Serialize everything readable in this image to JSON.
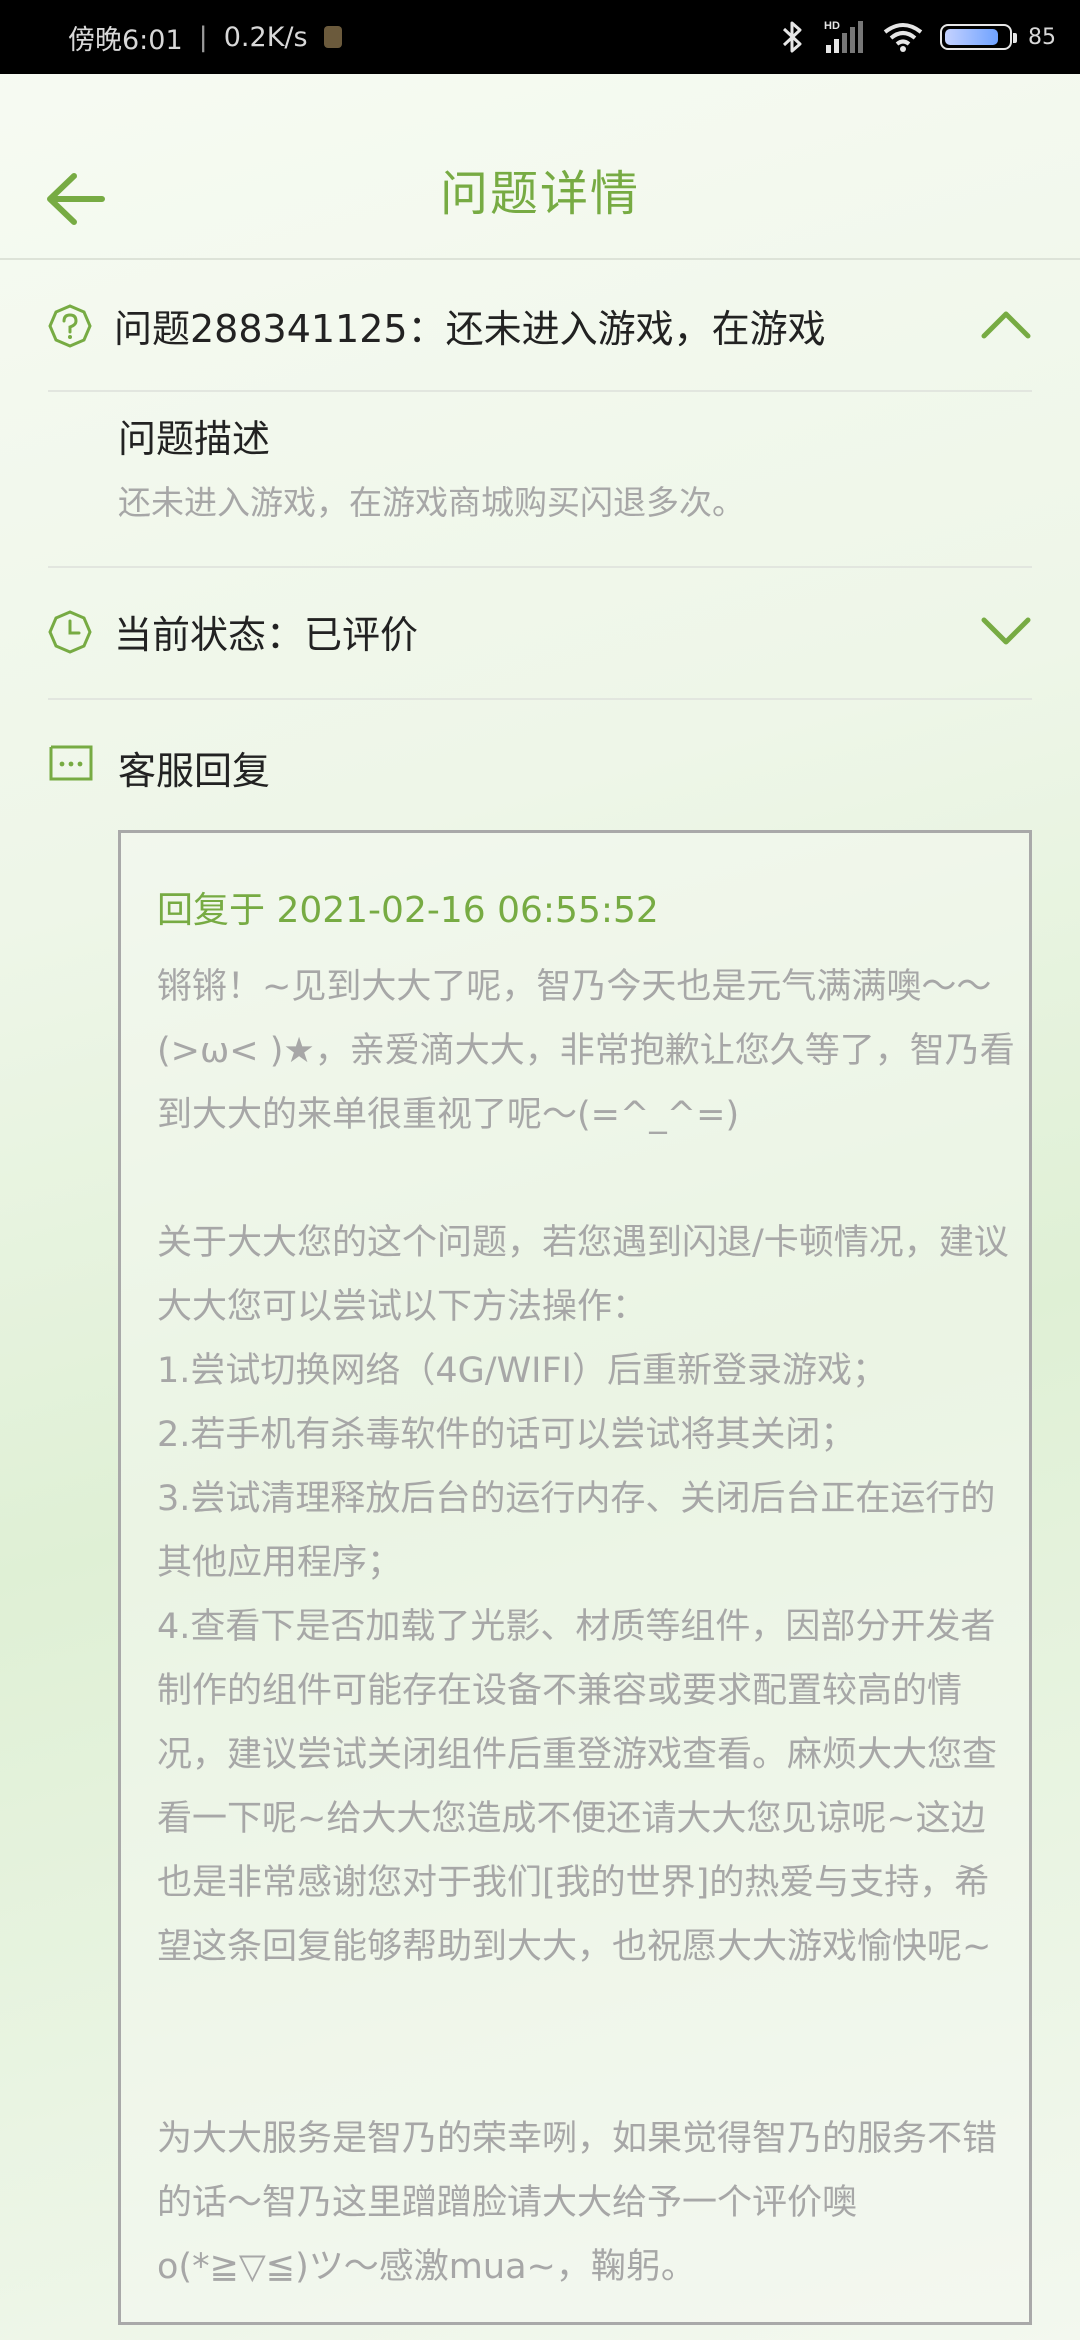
{
  "status_bar": {
    "time": "傍晚6:01",
    "network_speed": "0.2K/s",
    "battery_percent": "85",
    "battery_level": 0.85
  },
  "header": {
    "title": "问题详情",
    "back_icon": "arrow-left-icon"
  },
  "question": {
    "title": "问题288341125：还未进入游戏，在游戏",
    "icon": "question-circle-icon",
    "toggle_icon": "chevron-up-icon"
  },
  "description": {
    "label": "问题描述",
    "text": "还未进入游戏，在游戏商城购买闪退多次。"
  },
  "status": {
    "label": "当前状态：已评价",
    "icon": "clock-icon",
    "toggle_icon": "chevron-down-icon"
  },
  "reply": {
    "section_label": "客服回复",
    "icon": "message-icon",
    "time": "回复于 2021-02-16 06:55:52",
    "paragraphs": [
      "锵锵！~见到大大了呢，智乃今天也是元气满满噢～～(>ω< )★，亲爱滴大大，非常抱歉让您久等了，智乃看到大大的来单很重视了呢～(=^_^=)",
      "关于大大您的这个问题，若您遇到闪退/卡顿情况，建议大大您可以尝试以下方法操作：",
      "1.尝试切换网络（4G/WIFI）后重新登录游戏；",
      "2.若手机有杀毒软件的话可以尝试将其关闭；",
      "3.尝试清理释放后台的运行内存、关闭后台正在运行的其他应用程序；",
      "4.查看下是否加载了光影、材质等组件，因部分开发者制作的组件可能存在设备不兼容或要求配置较高的情况，建议尝试关闭组件后重登游戏查看。麻烦大大您查看一下呢~给大大您造成不便还请大大您见谅呢~这边也是非常感谢您对于我们[我的世界]的热爱与支持，希望这条回复能够帮助到大大，也祝愿大大游戏愉快呢~",
      "为大大服务是智乃的荣幸咧，如果觉得智乃的服务不错的话～智乃这里蹭蹭脸请大大给予一个评价噢 o(*≧▽≦)ツ～感激mua~，鞠躬。"
    ]
  },
  "colors": {
    "accent": "#77ab43",
    "text": "#222222",
    "muted": "#a7a7a7"
  }
}
